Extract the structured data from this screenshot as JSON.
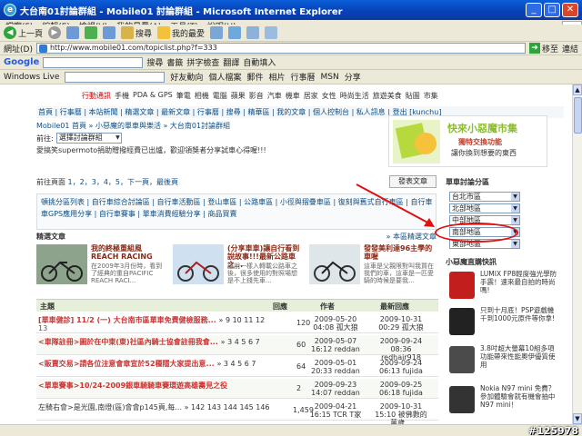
{
  "window": {
    "title": "大台南01討論群組 - Mobile01 討論群組 - Microsoft Internet Explorer",
    "ie_icon": "e",
    "controls": [
      "_",
      "□",
      "✕"
    ]
  },
  "menu": [
    "檔案(F)",
    "編輯(E)",
    "檢視(V)",
    "我的最愛(A)",
    "工具(T)",
    "說明(H)"
  ],
  "toolbar": {
    "back": "上一頁",
    "search": "搜尋",
    "favorites": "我的最愛"
  },
  "address": {
    "label": "網址(D)",
    "url": "http://www.mobile01.com/topiclist.php?f=333",
    "go_label": "移至",
    "links_label": "連結"
  },
  "google_bar": {
    "logo": "Google",
    "search_btn": "搜尋",
    "items": [
      "書籤",
      "拼字檢查",
      "翻譯",
      "自動填入"
    ]
  },
  "live_bar": {
    "logo": "Windows Live",
    "items": [
      "好友動向",
      "個人檔案",
      "郵件",
      "相片",
      "行事曆",
      "MSN",
      "分享"
    ]
  },
  "site": {
    "topnav": [
      "行動通訊",
      "手機",
      "PDA & GPS",
      "筆電",
      "相機",
      "電腦",
      "蘋果",
      "影音",
      "汽車",
      "機車",
      "居家",
      "女性",
      "時尚生活",
      "旅遊美食",
      "貼圖",
      "市集"
    ],
    "links": "首頁 | 行事曆 | 本站新聞 | 精選文章 | 最新文章 | 行事曆 | 搜尋 | 精華區 | 我的文章 | 個人控制台 | 私人訊息 | 登出 [kunchu]",
    "breadcrumb": "Mobile01 首頁 » 小惡魔的單車與樂活 » 大台南01討論群組",
    "goto_label": "前往:",
    "goto_select": "選擇討論群組",
    "goto_arrow": "▼",
    "notice": "愛搞笑supermoto捐助贈撥經費已出爐，歡迎領獎者分享試車心得喔!!!",
    "pages": {
      "prefix": "前往頁面",
      "nums": "1，2，3，4，5，下一頁，最後頁"
    },
    "post_button": "發表文章",
    "categories_row1": "頓挑分區列表 | 自行車綜合討論區 | 自行車活動區 | 登山車區 | 公路車區 | 小徑與摺疊車區 | 復刻與舊式自行車區 | 自行車道路與休閒旅遊 | 自行車改裝",
    "categories_row2": "車GPS應用分享 | 自行車賽事 | 單車消費經驗分享 | 商品買賣",
    "featured_head": "精選文章",
    "featured_more": "» 本區精選文章",
    "featured": [
      {
        "title": "我的終極重組風 REACH RACING",
        "desc": "在2009年3月份時，看到了經典的重自PACIFIC REACH RACI..."
      },
      {
        "title": "(分享車車)讓自行看到說故事!!!最新公路車之...",
        "desc": "雖說一樣入轉載公路車之後，很多使用的對照場想是不上錢先車..."
      },
      {
        "title": "發發美利達96主學的車喔",
        "desc": "這車是父親限對叫我買在我們的車，這車是一匹愛騎的時候是要我..."
      }
    ],
    "table_head": {
      "subject": "主題",
      "replies": "回應",
      "author": "作者",
      "last": "最新回應"
    },
    "rows": [
      {
        "subj": "[單車健診] 11/2 (一) 大台南市區單車免費健檢服務...",
        "pg": "» 9 10 11 12",
        "sub2": "13",
        "rep": "120",
        "auth": "2009-05-20 04:08 孤大狼",
        "last": "2009-10-31 00:29 孤大狼"
      },
      {
        "subj": "<車隊註冊>圖於在中東(東)社區內騎士協會註冊我會...",
        "pg": "» 3 4 5 6 7",
        "sub2": "",
        "rep": "60",
        "auth": "2009-05-07 16:12 reddan",
        "last": "2009-09-24 08:36 redhair918"
      },
      {
        "subj": "<販賣交易>請各位注意會章宣於52種隱大家提出意...",
        "pg": "» 3 4 5 6 7",
        "sub2": "",
        "rep": "64",
        "auth": "2009-05-01 20:33 reddan",
        "last": "2009-09-24 06:13 fujida"
      },
      {
        "subj": "<單車賽事>10/24-2009銀車騎騎車賽環遊高雄壽見之役",
        "pg": "",
        "sub2": "",
        "rep": "2",
        "auth": "2009-09-23 14:07 reddan",
        "last": "2009-09-25 06:18 fujida"
      },
      {
        "subj": "左騎右會>是光園,南燈(區)會會p145頁,每...",
        "pg": "» 142 143 144 145 146",
        "sub2": "",
        "rep": "1,459",
        "auth": "2009-04-21 16:15 TCR T家",
        "last": "2009-10-31 15:10 被佛數的萬歲..."
      }
    ],
    "sidebar": {
      "title": "單車討論分區",
      "dropdowns": [
        "台北市區",
        "北部地區",
        "中部地區",
        "南部地區",
        "東部地區"
      ],
      "shop_head": "小惡魔直購快訊",
      "products": [
        {
          "text": "LUMIX FP8輕度強光學防手震！速來最自拍的時尚嗎!"
        },
        {
          "text": "只到十月底！PSP遊戲機千到1000元原件等你拿!"
        },
        {
          "text": "3.8吋超大螢幕10組多項功能帶來性能奧伊優質使用"
        },
        {
          "text": "Nokia N97 mini 免費？參加體驗會就有機會抽中N97 mini！"
        }
      ]
    }
  },
  "status": {
    "left": "",
    "uid": "#125978"
  },
  "colors": {
    "accent_red": "#e01010",
    "title_blue": "#0842b8",
    "link_blue": "#0b4d86"
  }
}
